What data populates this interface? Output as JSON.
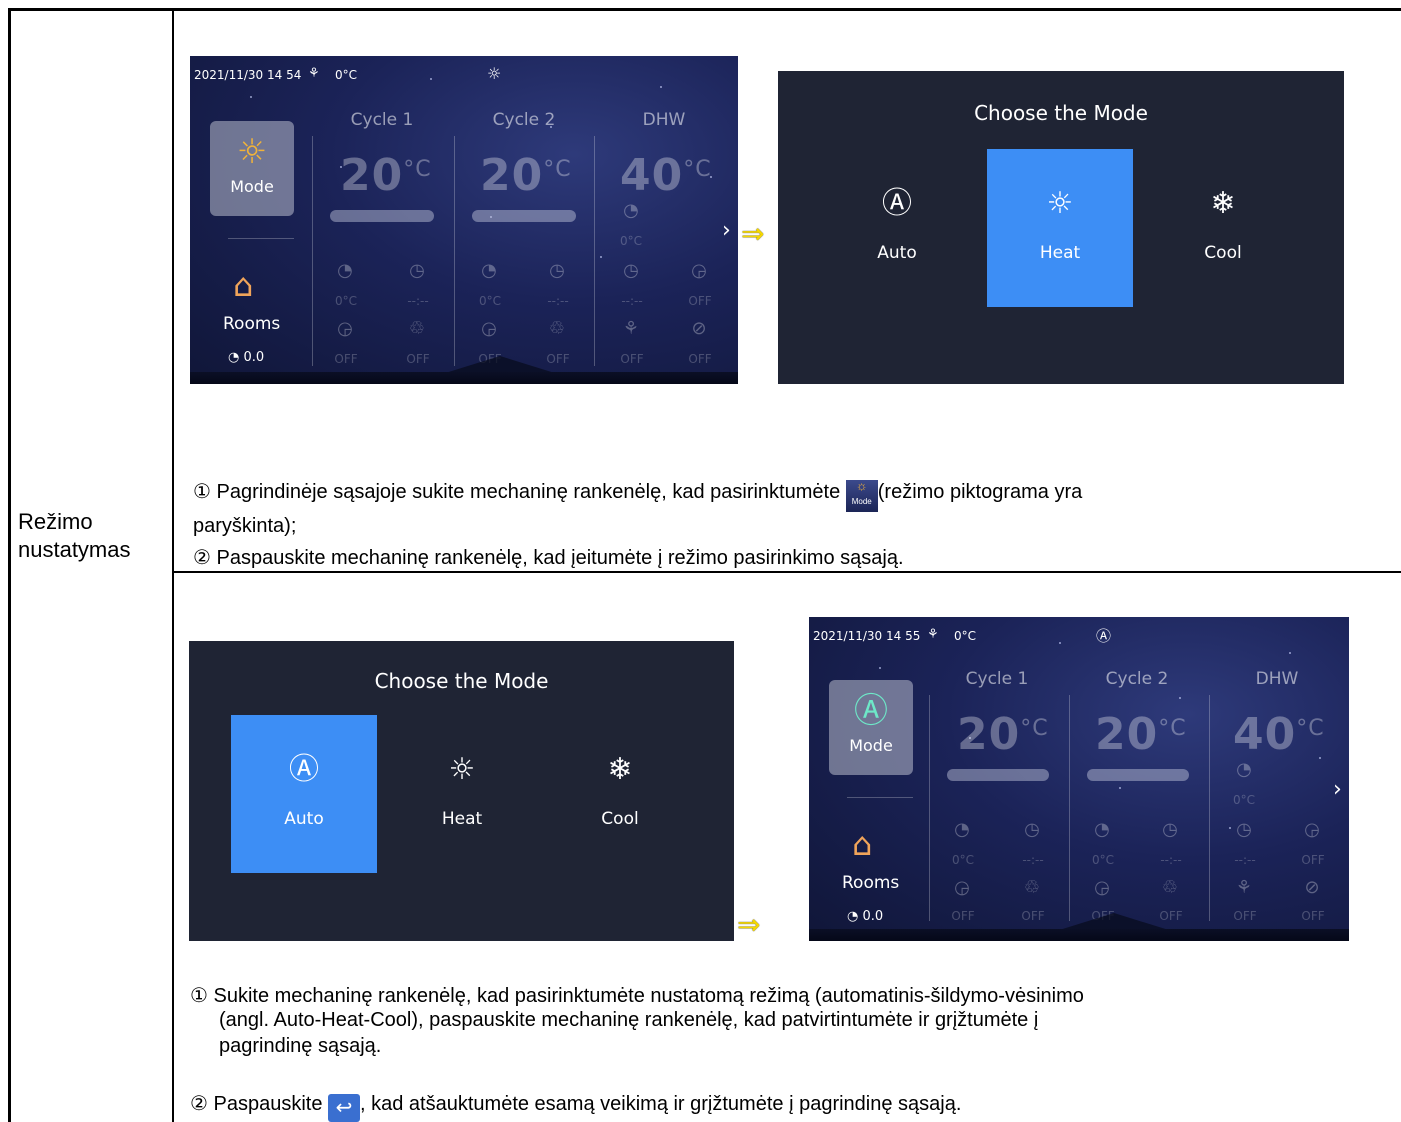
{
  "row_label": {
    "line1": "Režimo",
    "line2": "nustatymas"
  },
  "screen_a": {
    "status_datetime": "2021/11/30 14 54",
    "status_temp": "0°C",
    "mode_label": "Mode",
    "mode_glyph": "☼",
    "status_mode_glyph": "☼",
    "cycle1": "Cycle 1",
    "cycle2": "Cycle 2",
    "dhw": "DHW",
    "temp1": "20",
    "temp2": "20",
    "temp3": "40",
    "unit": "°C",
    "rooms_label": "Rooms",
    "pressure": "0.0",
    "val_0c": "0°C",
    "val_dash": "--:--",
    "val_off": "OFF"
  },
  "chooser_a": {
    "title": "Choose the Mode",
    "options": [
      {
        "label": "Auto",
        "glyph": "Ⓐ"
      },
      {
        "label": "Heat",
        "glyph": "☼"
      },
      {
        "label": "Cool",
        "glyph": "❄"
      }
    ],
    "selected": "Heat"
  },
  "instructions_a": {
    "line1_pre": "① Pagrindinėje sąsajoje sukite mechaninę rankenėlę, kad pasirinktumėte",
    "line1_post": "(režimo piktograma yra",
    "line1_cont": "paryškinta);",
    "line2": "② Paspauskite mechaninę rankenėlę, kad įeitumėte į režimo pasirinkimo sąsają.",
    "mini_icon_text": "Mode"
  },
  "chooser_b": {
    "title": "Choose the Mode",
    "options": [
      {
        "label": "Auto",
        "glyph": "Ⓐ"
      },
      {
        "label": "Heat",
        "glyph": "☼"
      },
      {
        "label": "Cool",
        "glyph": "❄"
      }
    ],
    "selected": "Auto"
  },
  "screen_b": {
    "status_datetime": "2021/11/30 14 55",
    "status_temp": "0°C",
    "mode_label": "Mode",
    "mode_glyph": "Ⓐ",
    "status_mode_glyph": "Ⓐ",
    "cycle1": "Cycle 1",
    "cycle2": "Cycle 2",
    "dhw": "DHW",
    "temp1": "20",
    "temp2": "20",
    "temp3": "40",
    "unit": "°C",
    "rooms_label": "Rooms",
    "pressure": "0.0",
    "val_0c": "0°C",
    "val_dash": "--:--",
    "val_off": "OFF"
  },
  "instructions_b": {
    "line1": "① Sukite mechaninę rankenėlę, kad pasirinktumėte nustatomą režimą (automatinis-šildymo-vėsinimo",
    "line2": "(angl. Auto-Heat-Cool), paspauskite mechaninę rankenėlę, kad patvirtintumėte ir grįžtumėte į",
    "line3": "pagrindinę sąsają.",
    "line4_pre": "② Paspauskite",
    "line4_post": ", kad atšauktumėte esamą veikimą ir grįžtumėte į pagrindinę sąsają."
  },
  "colors": {
    "selected_tile": "#3d8ef5",
    "dialog_bg": "#1f2434",
    "rooms_icon": "#f0a45a",
    "arrow": "#f5d800"
  }
}
